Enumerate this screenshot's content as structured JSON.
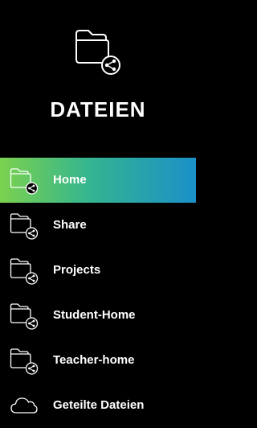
{
  "app": {
    "title": "DATEIEN",
    "logo_icon": "folder-share-icon"
  },
  "nav": {
    "items": [
      {
        "label": "Home",
        "icon": "folder-share-icon",
        "active": true
      },
      {
        "label": "Share",
        "icon": "folder-share-icon",
        "active": false
      },
      {
        "label": "Projects",
        "icon": "folder-share-icon",
        "active": false
      },
      {
        "label": "Student-Home",
        "icon": "folder-share-icon",
        "active": false
      },
      {
        "label": "Teacher-home",
        "icon": "folder-share-icon",
        "active": false
      },
      {
        "label": "Geteilte Dateien",
        "icon": "cloud-icon",
        "active": false
      }
    ]
  },
  "colors": {
    "background": "#000000",
    "text": "#ffffff",
    "active_gradient_start": "#7bd24e",
    "active_gradient_end": "#1a90c8"
  }
}
